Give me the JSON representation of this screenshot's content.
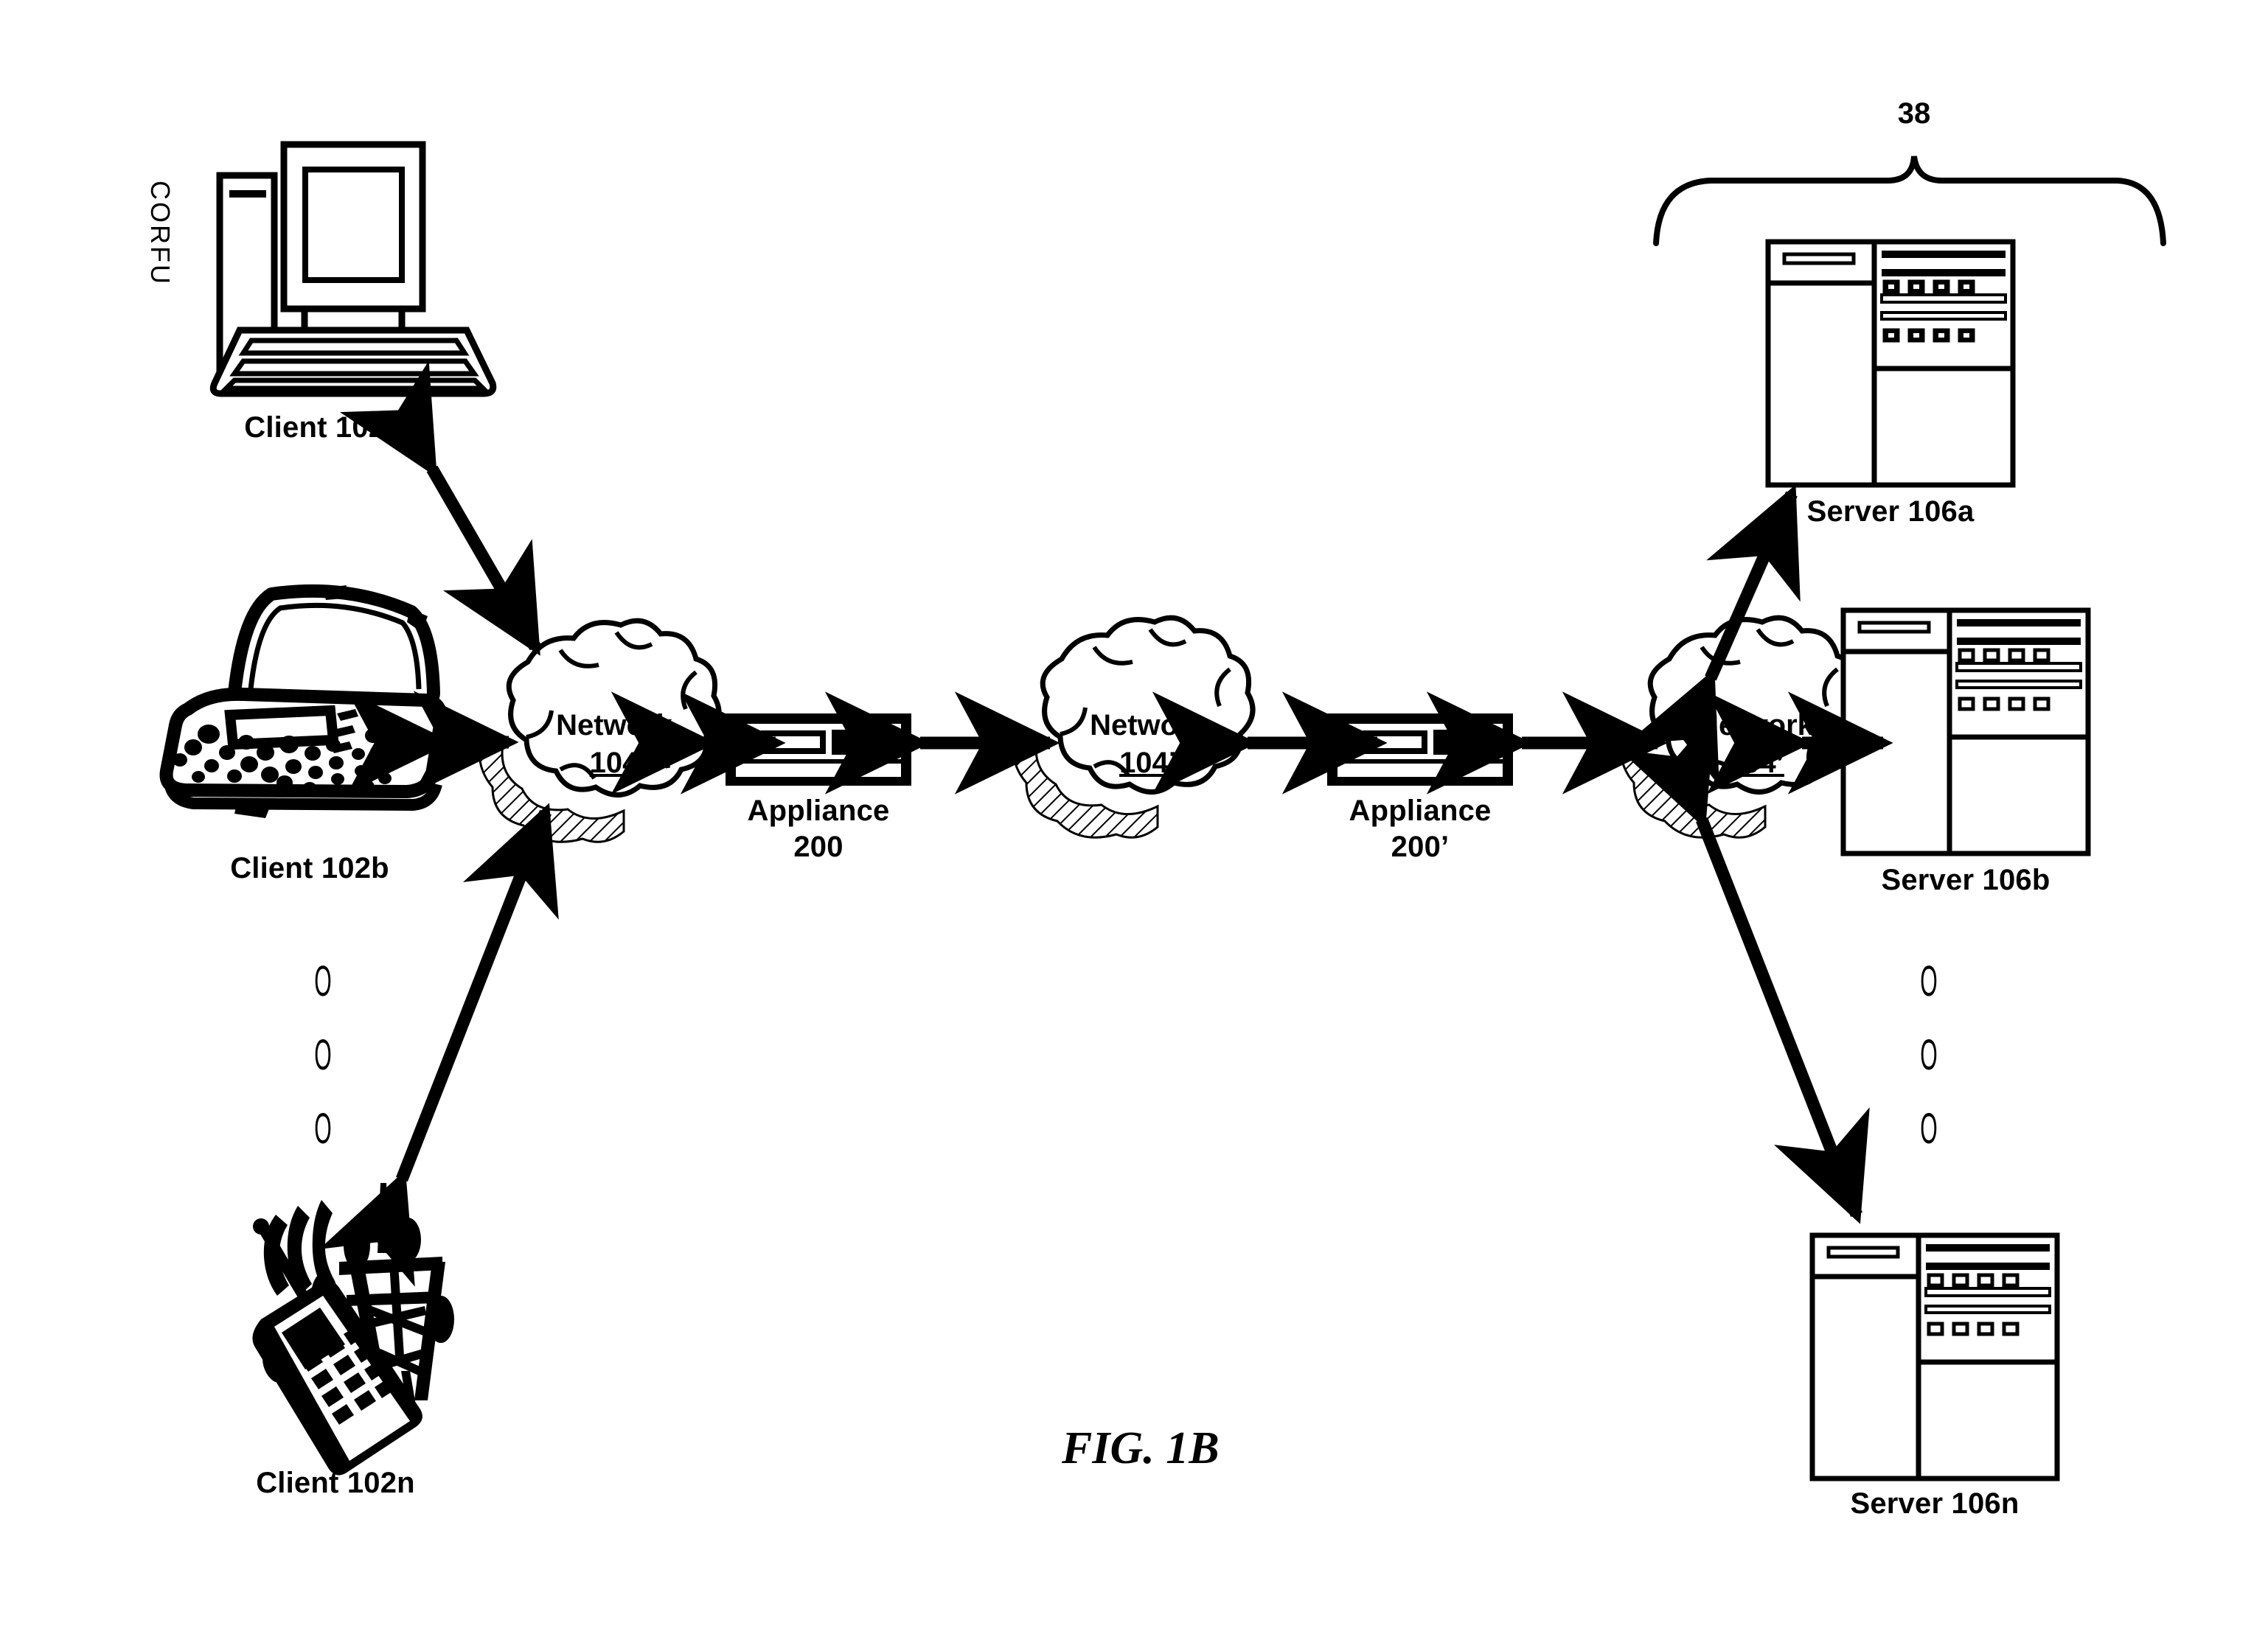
{
  "figure": {
    "caption": "FIG. 1B",
    "group_ref": "38",
    "watermark": "CORFU"
  },
  "clients": [
    {
      "id": "client-102a",
      "label": "Client 102a",
      "icon": "desktop-computer-icon"
    },
    {
      "id": "client-102b",
      "label": "Client 102b",
      "icon": "laptop-computer-icon"
    },
    {
      "id": "client-102n",
      "label": "Client 102n",
      "icon": "mobile-phone-tower-icon"
    }
  ],
  "client_ellipsis": [
    "O",
    "O",
    "O"
  ],
  "networks": [
    {
      "id": "network-104",
      "name": "Network",
      "ref": "104",
      "icon": "cloud-icon"
    },
    {
      "id": "network-104-prime-mid",
      "name": "Network",
      "ref": "104’",
      "icon": "cloud-icon"
    },
    {
      "id": "network-104-prime-right",
      "name": "Network",
      "ref": "104’",
      "icon": "cloud-icon"
    }
  ],
  "appliances": [
    {
      "id": "appliance-200",
      "name": "Appliance",
      "ref": "200",
      "icon": "network-appliance-icon"
    },
    {
      "id": "appliance-200-prime",
      "name": "Appliance",
      "ref": "200’",
      "icon": "network-appliance-icon"
    }
  ],
  "servers": [
    {
      "id": "server-106a",
      "label": "Server 106a",
      "icon": "server-tower-icon"
    },
    {
      "id": "server-106b",
      "label": "Server 106b",
      "icon": "server-tower-icon"
    },
    {
      "id": "server-106n",
      "label": "Server 106n",
      "icon": "server-tower-icon"
    }
  ],
  "server_ellipsis": [
    "O",
    "O",
    "O"
  ],
  "connections": [
    {
      "from": "client-102a",
      "to": "network-104",
      "style": "double-arrow"
    },
    {
      "from": "client-102b",
      "to": "network-104",
      "style": "double-arrow"
    },
    {
      "from": "client-102n",
      "to": "network-104",
      "style": "double-arrow"
    },
    {
      "from": "network-104",
      "to": "appliance-200",
      "style": "double-arrow"
    },
    {
      "from": "appliance-200",
      "to": "network-104-prime-mid",
      "style": "double-arrow"
    },
    {
      "from": "network-104-prime-mid",
      "to": "appliance-200-prime",
      "style": "double-arrow"
    },
    {
      "from": "appliance-200-prime",
      "to": "network-104-prime-right",
      "style": "double-arrow"
    },
    {
      "from": "network-104-prime-right",
      "to": "server-106a",
      "style": "double-arrow"
    },
    {
      "from": "network-104-prime-right",
      "to": "server-106b",
      "style": "double-arrow"
    },
    {
      "from": "network-104-prime-right",
      "to": "server-106n",
      "style": "double-arrow"
    }
  ],
  "colors": {
    "ink": "#000000",
    "paper": "#ffffff"
  }
}
